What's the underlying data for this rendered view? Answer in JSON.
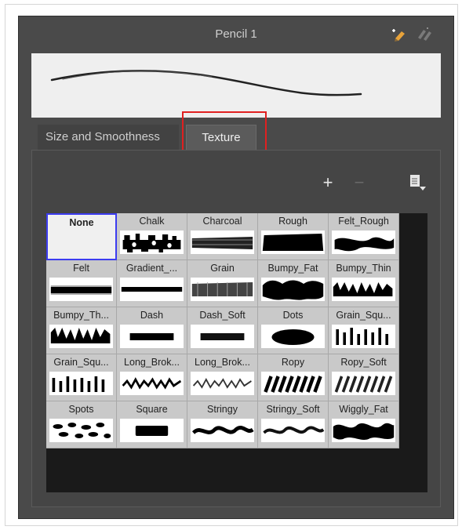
{
  "window": {
    "title": "Pencil 1",
    "accent_color": "#e02020"
  },
  "header_icons": [
    "new-pencil-icon",
    "pencil-options-icon"
  ],
  "tabs": [
    {
      "label": "Size and Smoothness",
      "active": false
    },
    {
      "label": "Texture",
      "active": true
    }
  ],
  "toolbar": {
    "add_label": "+",
    "remove_label": "−",
    "menu_icon": "menu-icon"
  },
  "textures": [
    {
      "name": "None",
      "selected": true
    },
    {
      "name": "Chalk"
    },
    {
      "name": "Charcoal"
    },
    {
      "name": "Rough"
    },
    {
      "name": "Felt_Rough"
    },
    {
      "name": "Felt"
    },
    {
      "name": "Gradient_..."
    },
    {
      "name": "Grain"
    },
    {
      "name": "Bumpy_Fat"
    },
    {
      "name": "Bumpy_Thin"
    },
    {
      "name": "Bumpy_Th..."
    },
    {
      "name": "Dash"
    },
    {
      "name": "Dash_Soft"
    },
    {
      "name": "Dots"
    },
    {
      "name": "Grain_Squ..."
    },
    {
      "name": "Grain_Squ..."
    },
    {
      "name": "Long_Brok..."
    },
    {
      "name": "Long_Brok..."
    },
    {
      "name": "Ropy"
    },
    {
      "name": "Ropy_Soft"
    },
    {
      "name": "Spots"
    },
    {
      "name": "Square"
    },
    {
      "name": "Stringy"
    },
    {
      "name": "Stringy_Soft"
    },
    {
      "name": "Wiggly_Fat"
    }
  ]
}
